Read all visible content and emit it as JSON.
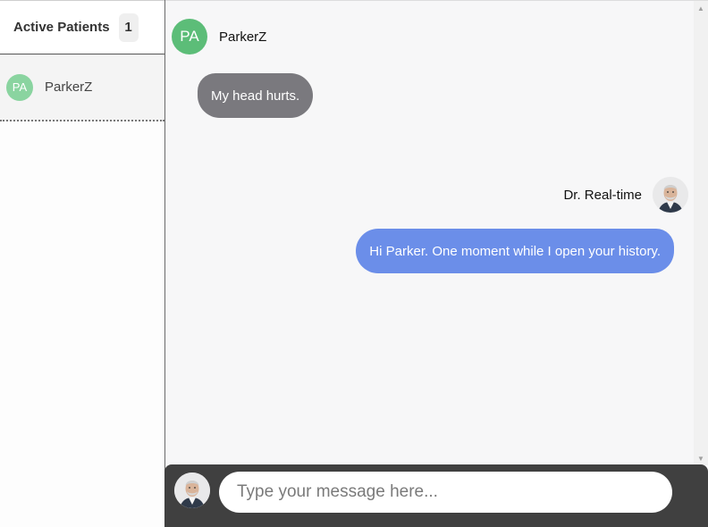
{
  "sidebar": {
    "title": "Active Patients",
    "count": "1",
    "patients": [
      {
        "initials": "PA",
        "name": "ParkerZ",
        "avatar_color": "#8ad4a0"
      }
    ]
  },
  "chat": {
    "incoming": {
      "initials": "PA",
      "name": "ParkerZ",
      "avatar_color": "#5cbd78",
      "text": "My head hurts.",
      "bubble_color": "#7a797e"
    },
    "outgoing": {
      "name": "Dr. Real-time",
      "text": "Hi Parker. One moment while I open your history.",
      "bubble_color": "#6b8ee9"
    }
  },
  "composer": {
    "placeholder": "Type your message here...",
    "value": ""
  },
  "icons": {
    "scroll_up": "scroll-up-arrow-icon",
    "scroll_down": "scroll-down-arrow-icon",
    "doctor_avatar": "doctor-portrait-icon"
  }
}
